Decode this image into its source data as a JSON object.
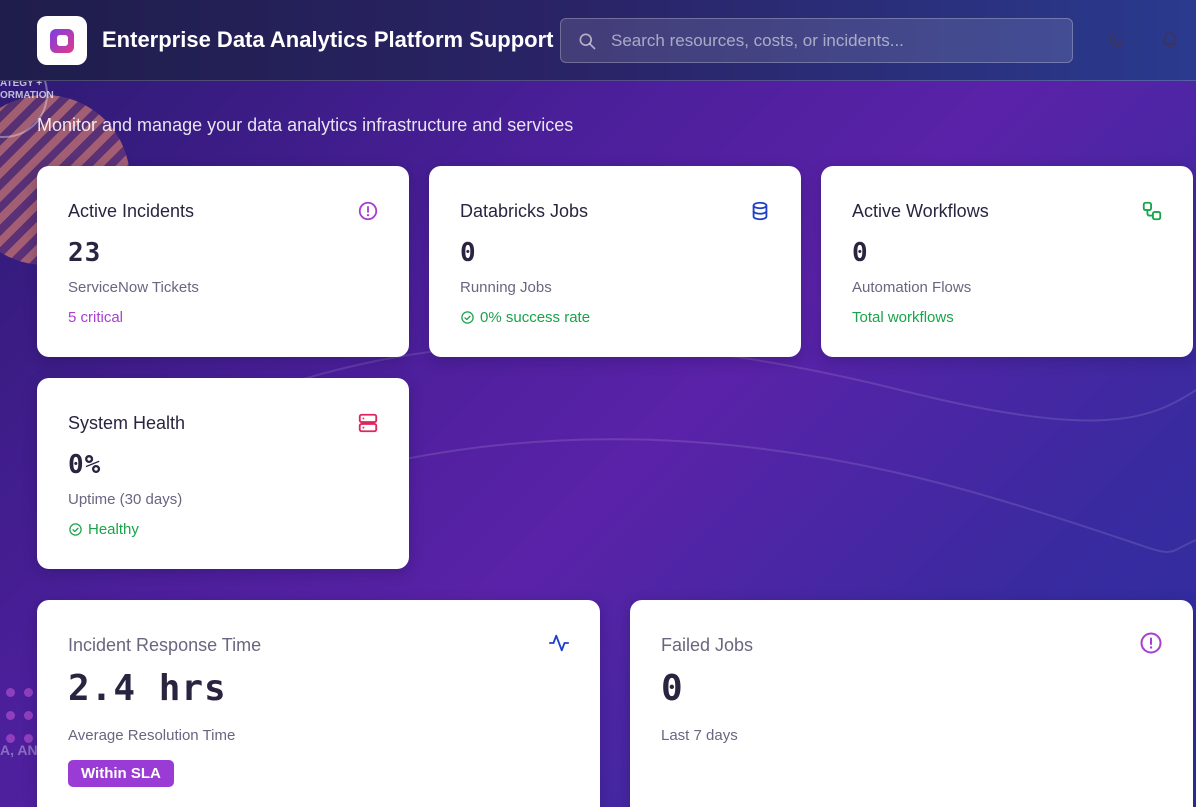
{
  "header": {
    "title": "Enterprise Data Analytics Platform Support",
    "search_placeholder": "Search resources, costs, or incidents..."
  },
  "background": {
    "ring_text": "ATEGY + ORMATION",
    "side_text": "A, AN"
  },
  "subtitle": "Monitor and manage your data analytics infrastructure and services",
  "cards": [
    {
      "title": "Active Incidents",
      "value": "23",
      "label": "ServiceNow Tickets",
      "note": "5 critical",
      "note_color": "#a83fd0",
      "icon": "alert-circle-icon",
      "icon_color": "#a83fd0"
    },
    {
      "title": "Databricks Jobs",
      "value": "0",
      "label": "Running Jobs",
      "note": "0% success rate",
      "note_color": "#1aa34a",
      "icon": "database-icon",
      "icon_color": "#1e40c8"
    },
    {
      "title": "Active Workflows",
      "value": "0",
      "label": "Automation Flows",
      "note": "Total workflows",
      "note_color": "#1aa34a",
      "icon": "workflow-icon",
      "icon_color": "#1aa34a"
    },
    {
      "title": "System Health",
      "value": "0%",
      "label": "Uptime (30 days)",
      "note": "Healthy",
      "note_color": "#1aa34a",
      "icon": "server-icon",
      "icon_color": "#e0245e"
    }
  ],
  "metrics": [
    {
      "title": "Incident Response Time",
      "value": "2.4 hrs",
      "label": "Average Resolution Time",
      "badge": "Within SLA",
      "icon": "activity-icon",
      "icon_color": "#1e40c8"
    },
    {
      "title": "Failed Jobs",
      "value": "0",
      "label": "Last 7 days",
      "icon": "alert-circle-icon",
      "icon_color": "#a83fd0"
    }
  ]
}
